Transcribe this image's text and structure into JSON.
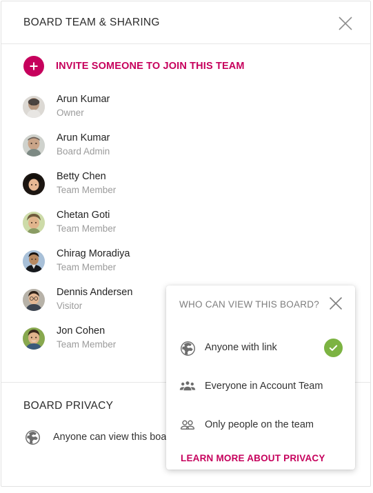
{
  "header": {
    "title": "BOARD TEAM & SHARING",
    "close_icon": "close-icon"
  },
  "invite": {
    "label": "INVITE SOMEONE TO JOIN THIS TEAM",
    "icon": "plus-icon",
    "accent_color": "#c6005c"
  },
  "members": [
    {
      "name": "Arun Kumar",
      "role": "Owner",
      "avatar": "avatar-arun-kumar-1"
    },
    {
      "name": "Arun Kumar",
      "role": "Board Admin",
      "avatar": "avatar-arun-kumar-2"
    },
    {
      "name": "Betty Chen",
      "role": "Team Member",
      "avatar": "avatar-betty-chen"
    },
    {
      "name": "Chetan Goti",
      "role": "Team Member",
      "avatar": "avatar-chetan-goti"
    },
    {
      "name": "Chirag Moradiya",
      "role": "Team Member",
      "avatar": "avatar-chirag-moradiya"
    },
    {
      "name": "Dennis Andersen",
      "role": "Visitor",
      "avatar": "avatar-dennis-andersen"
    },
    {
      "name": "Jon Cohen",
      "role": "Team Member",
      "avatar": "avatar-jon-cohen"
    }
  ],
  "privacy": {
    "title": "BOARD PRIVACY",
    "value": "Anyone can view this board",
    "icon": "globe-icon"
  },
  "popup": {
    "title": "WHO CAN VIEW THIS BOARD?",
    "close_icon": "close-icon",
    "options": [
      {
        "label": "Anyone with link",
        "icon": "globe-icon",
        "selected": true
      },
      {
        "label": "Everyone in Account Team",
        "icon": "group-icon",
        "selected": false
      },
      {
        "label": "Only people on the team",
        "icon": "two-people-icon",
        "selected": false
      }
    ],
    "link_label": "LEARN MORE ABOUT PRIVACY",
    "selected_color": "#7cb342",
    "link_color": "#c6005c"
  }
}
